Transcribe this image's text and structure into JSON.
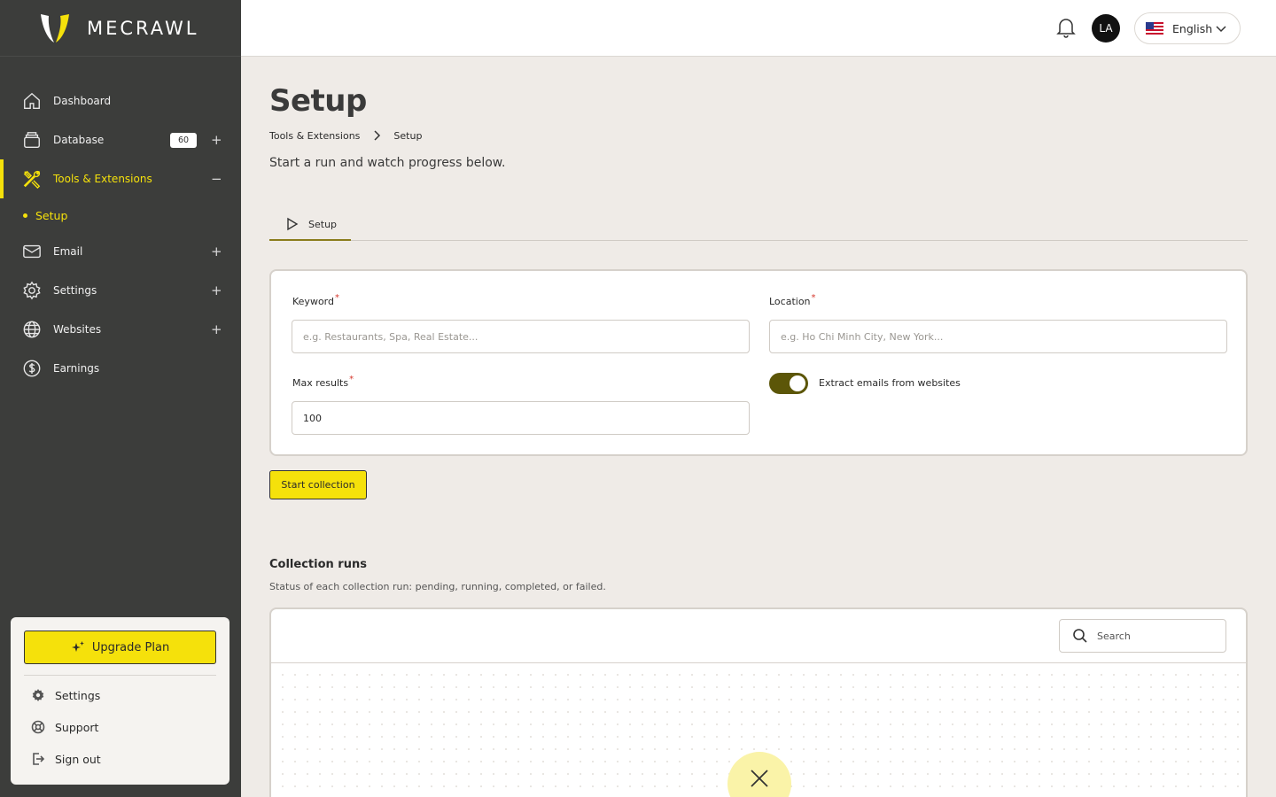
{
  "brand": {
    "name": "MECRAWL"
  },
  "sidebar": {
    "items": [
      {
        "label": "Dashboard",
        "icon": "home-icon"
      },
      {
        "label": "Database",
        "icon": "database-icon",
        "badge": "60",
        "action": "+"
      },
      {
        "label": "Tools & Extensions",
        "icon": "tools-icon",
        "action": "−",
        "active": true
      },
      {
        "label": "Email",
        "icon": "mail-icon",
        "action": "+"
      },
      {
        "label": "Settings",
        "icon": "gear-icon",
        "action": "+"
      },
      {
        "label": "Websites",
        "icon": "globe-icon",
        "action": "+"
      },
      {
        "label": "Earnings",
        "icon": "dollar-icon"
      }
    ],
    "sub_item": {
      "label": "Setup"
    },
    "card": {
      "upgrade_label": "Upgrade Plan",
      "links": [
        {
          "label": "Settings",
          "icon": "gear-icon"
        },
        {
          "label": "Support",
          "icon": "lifebuoy-icon"
        },
        {
          "label": "Sign out",
          "icon": "sign-out-icon"
        }
      ]
    }
  },
  "header": {
    "avatar_initials": "LA",
    "language": "English"
  },
  "page": {
    "title": "Setup",
    "breadcrumbs": [
      "Tools & Extensions",
      "Setup"
    ],
    "subtitle": "Start a run and watch progress below.",
    "tab_label": "Setup"
  },
  "form": {
    "keyword": {
      "label": "Keyword",
      "placeholder": "e.g. Restaurants, Spa, Real Estate..."
    },
    "location": {
      "label": "Location",
      "placeholder": "e.g. Ho Chi Minh City, New York..."
    },
    "max_results": {
      "label": "Max results",
      "value": "100"
    },
    "required_mark": "*",
    "extract_toggle": {
      "label": "Extract emails from websites",
      "on": true
    },
    "submit_label": "Start collection"
  },
  "runs": {
    "title": "Collection runs",
    "description": "Status of each collection run: pending, running, completed, or failed.",
    "search_placeholder": "Search"
  },
  "colors": {
    "accent": "#f5e10b",
    "sidebar_bg": "#3c3d3b",
    "page_bg": "#efebe7",
    "toggle_on": "#5c5608"
  }
}
